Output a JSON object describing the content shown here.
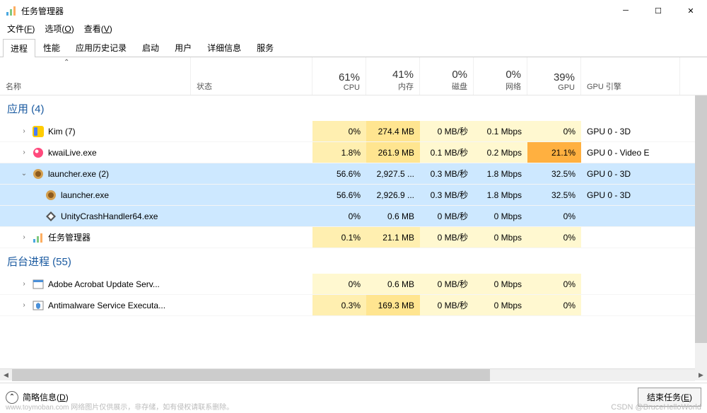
{
  "window": {
    "title": "任务管理器"
  },
  "menubar": [
    {
      "label": "文件",
      "key": "F"
    },
    {
      "label": "选项",
      "key": "O"
    },
    {
      "label": "查看",
      "key": "V"
    }
  ],
  "tabs": [
    {
      "label": "进程",
      "active": true
    },
    {
      "label": "性能",
      "active": false
    },
    {
      "label": "应用历史记录",
      "active": false
    },
    {
      "label": "启动",
      "active": false
    },
    {
      "label": "用户",
      "active": false
    },
    {
      "label": "详细信息",
      "active": false
    },
    {
      "label": "服务",
      "active": false
    }
  ],
  "columns": {
    "name": "名称",
    "status": "状态",
    "cpu": {
      "pct": "61%",
      "label": "CPU"
    },
    "memory": {
      "pct": "41%",
      "label": "内存"
    },
    "disk": {
      "pct": "0%",
      "label": "磁盘"
    },
    "network": {
      "pct": "0%",
      "label": "网络"
    },
    "gpu": {
      "pct": "39%",
      "label": "GPU"
    },
    "gpuengine": "GPU 引擎"
  },
  "groups": {
    "apps": {
      "label": "应用",
      "count": "(4)"
    },
    "background": {
      "label": "后台进程",
      "count": "(55)"
    }
  },
  "rows": [
    {
      "type": "app",
      "expand": "›",
      "indent": 1,
      "icon": "kim",
      "name": "Kim (7)",
      "cpu": "0%",
      "mem": "274.4 MB",
      "disk": "0 MB/秒",
      "net": "0.1 Mbps",
      "gpu": "0%",
      "eng": "GPU 0 - 3D",
      "heat": [
        "heat-2",
        "heat-3",
        "heat-1",
        "heat-1",
        "heat-1"
      ]
    },
    {
      "type": "app",
      "expand": "›",
      "indent": 1,
      "icon": "kwai",
      "name": "kwaiLive.exe",
      "cpu": "1.8%",
      "mem": "261.9 MB",
      "disk": "0.1 MB/秒",
      "net": "0.2 Mbps",
      "gpu": "21.1%",
      "eng": "GPU 0 - Video E",
      "heat": [
        "heat-2",
        "heat-3",
        "heat-1",
        "heat-1",
        "heat-5"
      ]
    },
    {
      "type": "app",
      "expand": "⌄",
      "indent": 1,
      "icon": "launcher",
      "name": "launcher.exe (2)",
      "cpu": "56.6%",
      "mem": "2,927.5 ...",
      "disk": "0.3 MB/秒",
      "net": "1.8 Mbps",
      "gpu": "32.5%",
      "eng": "GPU 0 - 3D",
      "selected": true,
      "heat": [
        "heat-gray",
        "heat-gray",
        "heat-gray",
        "heat-gray",
        "heat-blue2"
      ]
    },
    {
      "type": "child",
      "indent": 2,
      "icon": "launcher",
      "name": "launcher.exe",
      "cpu": "56.6%",
      "mem": "2,926.9 ...",
      "disk": "0.3 MB/秒",
      "net": "1.8 Mbps",
      "gpu": "32.5%",
      "eng": "GPU 0 - 3D",
      "selected": true,
      "heat": [
        "heat-gray",
        "heat-gray",
        "heat-gray",
        "heat-gray",
        "heat-blue2"
      ]
    },
    {
      "type": "child",
      "indent": 2,
      "icon": "unity",
      "name": "UnityCrashHandler64.exe",
      "cpu": "0%",
      "mem": "0.6 MB",
      "disk": "0 MB/秒",
      "net": "0 Mbps",
      "gpu": "0%",
      "eng": "",
      "selected": true,
      "heat": [
        "heat-blue0",
        "heat-blue0",
        "heat-blue0",
        "heat-blue0",
        "heat-blue0"
      ]
    },
    {
      "type": "app",
      "expand": "›",
      "indent": 1,
      "icon": "taskmgr",
      "name": "任务管理器",
      "cpu": "0.1%",
      "mem": "21.1 MB",
      "disk": "0 MB/秒",
      "net": "0 Mbps",
      "gpu": "0%",
      "eng": "",
      "heat": [
        "heat-2",
        "heat-2",
        "heat-1",
        "heat-1",
        "heat-1"
      ]
    },
    {
      "type": "bg",
      "expand": "›",
      "indent": 1,
      "icon": "adobe",
      "name": "Adobe Acrobat Update Serv...",
      "cpu": "0%",
      "mem": "0.6 MB",
      "disk": "0 MB/秒",
      "net": "0 Mbps",
      "gpu": "0%",
      "eng": "",
      "heat": [
        "heat-1",
        "heat-1",
        "heat-1",
        "heat-1",
        "heat-1"
      ]
    },
    {
      "type": "bg",
      "expand": "›",
      "indent": 1,
      "icon": "antimalware",
      "name": "Antimalware Service Executa...",
      "cpu": "0.3%",
      "mem": "169.3 MB",
      "disk": "0 MB/秒",
      "net": "0 Mbps",
      "gpu": "0%",
      "eng": "",
      "heat": [
        "heat-2",
        "heat-3",
        "heat-1",
        "heat-1",
        "heat-1"
      ]
    }
  ],
  "footer": {
    "brief": "简略信息",
    "brief_key": "D",
    "end_task": "结束任务",
    "end_task_key": "E"
  },
  "watermark": {
    "left": "www.toymoban.com  网络图片仅供展示，非存储，如有侵权请联系删除。",
    "right": "CSDN @BruceHelloWorld"
  },
  "sort_indicator": "⌃"
}
